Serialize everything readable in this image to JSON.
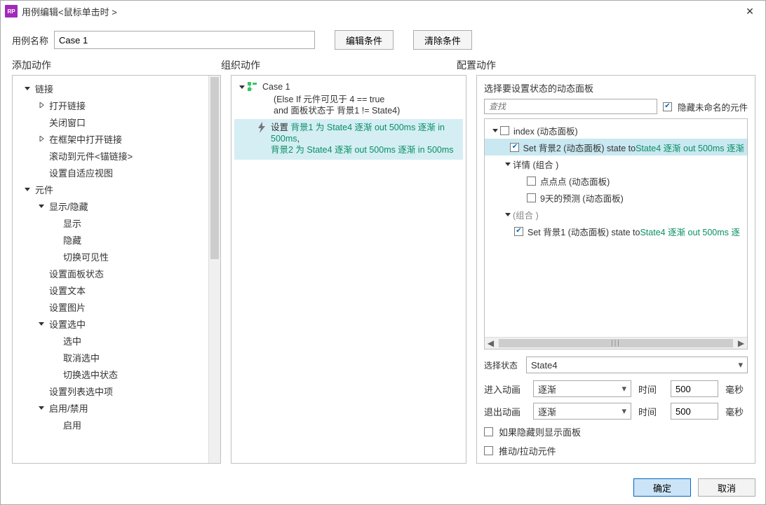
{
  "titlebar": {
    "app_abbrev": "RP",
    "title": "用例编辑<鼠标单击时 >"
  },
  "top": {
    "case_name_label": "用例名称",
    "case_name_value": "Case 1",
    "edit_cond": "编辑条件",
    "clear_cond": "清除条件"
  },
  "col_headers": {
    "left": "添加动作",
    "mid": "组织动作",
    "right": "配置动作"
  },
  "left_tree": [
    {
      "depth": 0,
      "caret": "down",
      "label": "链接"
    },
    {
      "depth": 1,
      "caret": "right",
      "label": "打开链接"
    },
    {
      "depth": 1,
      "caret": "none",
      "label": "关闭窗口"
    },
    {
      "depth": 1,
      "caret": "right",
      "label": "在框架中打开链接"
    },
    {
      "depth": 1,
      "caret": "none",
      "label": "滚动到元件<锚链接>"
    },
    {
      "depth": 1,
      "caret": "none",
      "label": "设置自适应视图"
    },
    {
      "depth": 0,
      "caret": "down",
      "label": "元件"
    },
    {
      "depth": 1,
      "caret": "down",
      "label": "显示/隐藏"
    },
    {
      "depth": 2,
      "caret": "none",
      "label": "显示"
    },
    {
      "depth": 2,
      "caret": "none",
      "label": "隐藏"
    },
    {
      "depth": 2,
      "caret": "none",
      "label": "切换可见性"
    },
    {
      "depth": 1,
      "caret": "none",
      "label": "设置面板状态"
    },
    {
      "depth": 1,
      "caret": "none",
      "label": "设置文本"
    },
    {
      "depth": 1,
      "caret": "none",
      "label": "设置图片"
    },
    {
      "depth": 1,
      "caret": "down",
      "label": "设置选中"
    },
    {
      "depth": 2,
      "caret": "none",
      "label": "选中"
    },
    {
      "depth": 2,
      "caret": "none",
      "label": "取消选中"
    },
    {
      "depth": 2,
      "caret": "none",
      "label": "切换选中状态"
    },
    {
      "depth": 1,
      "caret": "none",
      "label": "设置列表选中项"
    },
    {
      "depth": 1,
      "caret": "down",
      "label": "启用/禁用"
    },
    {
      "depth": 2,
      "caret": "none",
      "label": "启用"
    }
  ],
  "mid": {
    "case_label": "Case 1",
    "cond1": "(Else If 元件可见于 4 == true",
    "cond2": "and 面板状态于 背景1 != State4)",
    "action_pre": "设置 ",
    "action_l1a": "背景1 为 State4 逐渐 out 500ms 逐渐 in 500ms",
    "action_l1b": ",",
    "action_l2": "背景2 为 State4 逐渐 out 500ms 逐渐 in 500ms"
  },
  "right": {
    "section_title": "选择要设置状态的动态面板",
    "search_placeholder": "查找",
    "hide_unnamed": "隐藏未命名的元件",
    "tree": {
      "n0": "index (动态面板)",
      "n1_pre": "Set 背景2 (动态面板) state to ",
      "n1_suf": "State4 逐渐 out 500ms 逐渐",
      "n2": "详情 (组合 )",
      "n3": "点点点 (动态面板)",
      "n4": "9天的预测 (动态面板)",
      "n5": "(组合 )",
      "n6_pre": "Set 背景1 (动态面板) state to ",
      "n6_suf": "State4 逐渐 out 500ms 逐"
    },
    "select_state_label": "选择状态",
    "select_state_value": "State4",
    "anim_in_label": "进入动画",
    "anim_out_label": "退出动画",
    "anim_val": "逐渐",
    "time_label": "时间",
    "time_in": "500",
    "time_out": "500",
    "ms": "毫秒",
    "opt1": "如果隐藏则显示面板",
    "opt2": "推动/拉动元件"
  },
  "footer": {
    "ok": "确定",
    "cancel": "取消"
  }
}
